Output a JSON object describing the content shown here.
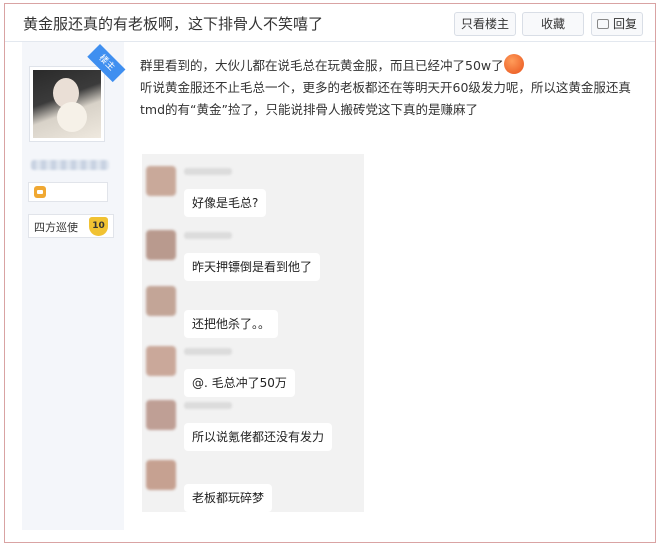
{
  "thread": {
    "title": "黄金服还真的有老板啊，这下排骨人不笑嘻了",
    "buttons": {
      "only_op": "只看楼主",
      "favorite": "收藏",
      "reply": "回复"
    }
  },
  "author": {
    "badge": "楼主",
    "rank_title": "四方巡使",
    "rank_level": "10",
    "colors": {
      "badge": "#3f8ff0",
      "level_icon": "#f0a832",
      "rank_shield": "#f1c232"
    }
  },
  "post": {
    "lines": [
      "群里看到的，大伙儿都在说毛总在玩黄金服，而且已经冲了50w了",
      "听说黄金服还不止毛总一个，更多的老板都还在等明天开60级发力呢，所以这黄金服还真",
      "tmd的有“黄金”捡了，只能说排骨人搬砖党这下真的是赚麻了"
    ],
    "emoji_icon": "angry-face-emoji-icon"
  },
  "chat_screenshot": {
    "messages": [
      {
        "text": "好像是毛总?"
      },
      {
        "text": "昨天押镖倒是看到他了"
      },
      {
        "text": "还把他杀了。。"
      },
      {
        "text": "@. 毛总冲了50万"
      },
      {
        "text": "所以说氪佬都还没有发力"
      },
      {
        "text": "老板都玩碎梦"
      }
    ]
  }
}
